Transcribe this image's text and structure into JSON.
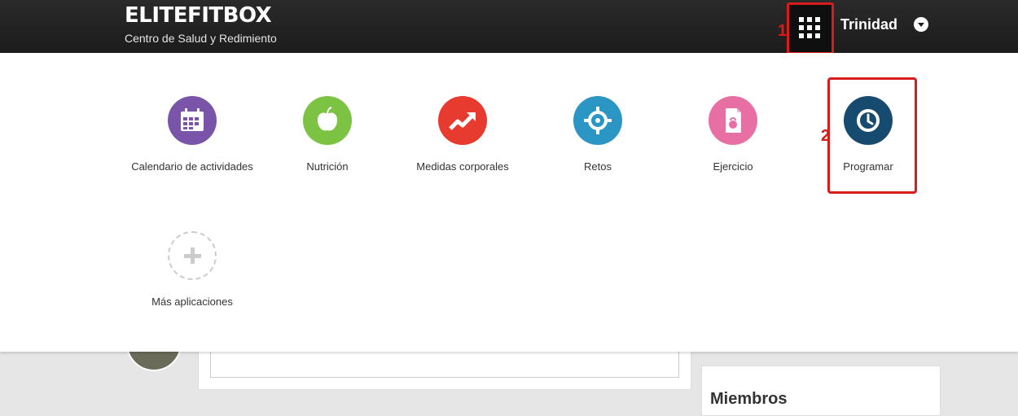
{
  "header": {
    "brand": "ELITEFITBOX",
    "tagline": "Centro de Salud y Redimiento",
    "user_name": "Trinidad",
    "apps_button_icon": "grid-icon",
    "user_menu_icon": "chevron-down-icon"
  },
  "annotations": {
    "one": "1",
    "two": "2",
    "color": "#d81c1c"
  },
  "apps": [
    {
      "label": "Calendario de actividades",
      "icon": "calendar-icon",
      "color": "#7a54a8"
    },
    {
      "label": "Nutrición",
      "icon": "apple-icon",
      "color": "#7cc243"
    },
    {
      "label": "Medidas corporales",
      "icon": "trend-arrow-icon",
      "color": "#e63b2e"
    },
    {
      "label": "Retos",
      "icon": "crosshair-icon",
      "color": "#2b96c4"
    },
    {
      "label": "Ejercicio",
      "icon": "kettlebell-icon",
      "color": "#e86fa3"
    },
    {
      "label": "Programar",
      "icon": "clock-icon",
      "color": "#164a6e"
    },
    {
      "label": "Más aplicaciones",
      "icon": "plus-icon",
      "color": "#ffffff"
    }
  ],
  "sidebar": {
    "members_title": "Miembros"
  }
}
